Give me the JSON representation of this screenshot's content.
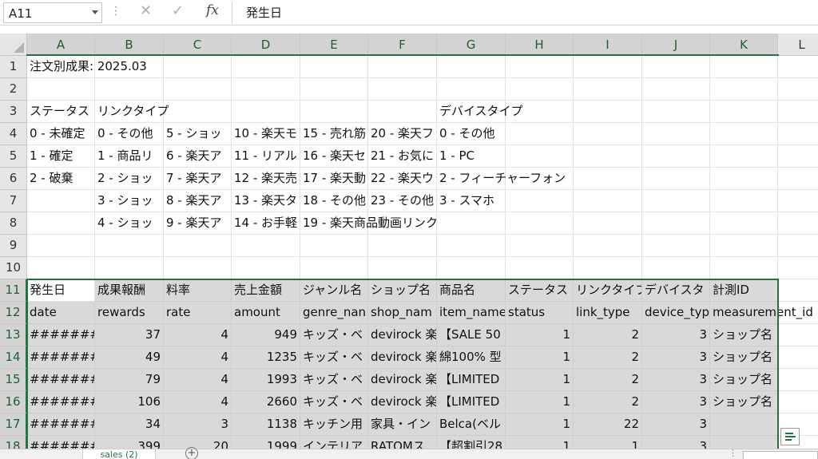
{
  "formula_bar": {
    "name_box": "A11",
    "dots": "⋮",
    "cancel_icon": "✕",
    "enter_icon": "✓",
    "fx": "fx",
    "content": "発生日"
  },
  "columns": [
    "A",
    "B",
    "C",
    "D",
    "E",
    "F",
    "G",
    "H",
    "I",
    "J",
    "K",
    "L"
  ],
  "rows": [
    "1",
    "2",
    "3",
    "4",
    "5",
    "6",
    "7",
    "8",
    "9",
    "10",
    "11",
    "12",
    "13",
    "14",
    "15",
    "16",
    "17",
    "18"
  ],
  "cells": {
    "A1": "注文別成果: 2025.03",
    "A3": "ステータス",
    "B3": "リンクタイプ",
    "G3": "デバイスタイプ",
    "A4": "0 - 未確定",
    "B4": "0 - その他",
    "C4": "5 - ショッ",
    "D4": "10 - 楽天モ",
    "E4": "15 - 売れ筋",
    "F4": "20 - 楽天フ",
    "G4": "0 - その他",
    "A5": "1 - 確定",
    "B5": "1 - 商品リ",
    "C5": "6 - 楽天ア",
    "D5": "11 - リアル",
    "E5": "16 - 楽天セ",
    "F5": "21 - お気に",
    "G5": "1 - PC",
    "A6": "2 - 破棄",
    "B6": "2 - ショッ",
    "C6": "7 - 楽天ア",
    "D6": "12 - 楽天売",
    "E6": "17 - 楽天動",
    "F6": "22 - 楽天ウ",
    "G6": "2 - フィーチャーフォン",
    "B7": "3 - ショッ",
    "C7": "8 - 楽天ア",
    "D7": "13 - 楽天タ",
    "E7": "18 - その他",
    "F7": "23 - その他",
    "G7": "3 - スマホ",
    "B8": "4 - ショッ",
    "C8": "9 - 楽天ア",
    "D8": "14 - お手軽",
    "E8": "19 - 楽天商品動画リンク"
  },
  "table": {
    "header_jp": [
      "発生日",
      "成果報酬",
      "料率",
      "売上金額",
      "ジャンル名",
      "ショップ名",
      "商品名",
      "ステータス",
      "リンクタイプ",
      "デバイスタ",
      "計測ID"
    ],
    "header_en": [
      "date",
      "rewards",
      "rate",
      "amount",
      "genre_nan",
      "shop_nam",
      "item_name",
      "status",
      "link_type",
      "device_typ",
      "measurement_id"
    ],
    "rows": [
      [
        "#######",
        "37",
        "4",
        "949",
        "キッズ・ベ",
        "devirock 楽",
        "【SALE 50",
        "1",
        "2",
        "3",
        "ショップ名"
      ],
      [
        "#######",
        "49",
        "4",
        "1235",
        "キッズ・ベ",
        "devirock 楽",
        "綿100% 型",
        "1",
        "2",
        "3",
        "ショップ名"
      ],
      [
        "#######",
        "79",
        "4",
        "1993",
        "キッズ・ベ",
        "devirock 楽",
        "【LIMITED",
        "1",
        "2",
        "3",
        "ショップ名"
      ],
      [
        "#######",
        "106",
        "4",
        "2660",
        "キッズ・ベ",
        "devirock 楽",
        "【LIMITED",
        "1",
        "2",
        "3",
        "ショップ名"
      ],
      [
        "#######",
        "34",
        "3",
        "1138",
        "キッチン用",
        "家具・イン",
        "Belca(ベル",
        "1",
        "22",
        "3",
        ""
      ],
      [
        "#######",
        "399",
        "20",
        "1999",
        "インテリア",
        "RATOMス",
        "【超割引28",
        "1",
        "1",
        "3",
        ""
      ]
    ]
  },
  "sheet_tab": "sales (2)",
  "add_sheet": "+",
  "bottom_dots": "⋮",
  "colors": {
    "accent": "#217346",
    "selection_fill": "#d9d9d9",
    "header_fill": "#e6e6e6"
  }
}
